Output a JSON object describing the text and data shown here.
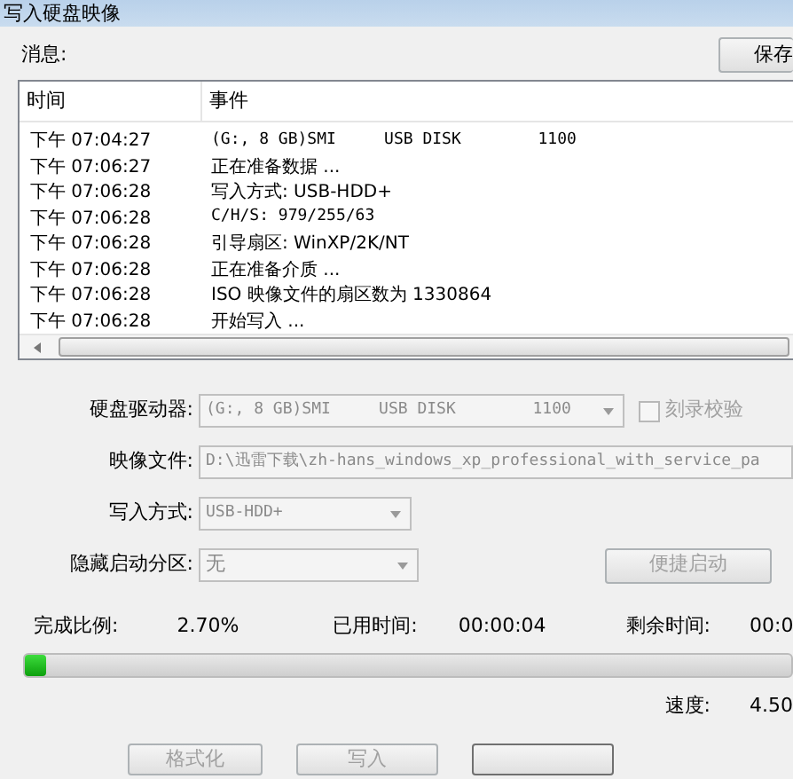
{
  "window": {
    "title": "写入硬盘映像"
  },
  "messages": {
    "label": "消息:",
    "save_button": "保存",
    "columns": [
      "时间",
      "事件"
    ],
    "rows": [
      {
        "time": "下午 07:04:27",
        "event": "(G:, 8 GB)SMI     USB DISK        1100"
      },
      {
        "time": "下午 07:06:27",
        "event": "正在准备数据 ..."
      },
      {
        "time": "下午 07:06:28",
        "event": "写入方式: USB-HDD+"
      },
      {
        "time": "下午 07:06:28",
        "event": "C/H/S: 979/255/63"
      },
      {
        "time": "下午 07:06:28",
        "event": "引导扇区: WinXP/2K/NT"
      },
      {
        "time": "下午 07:06:28",
        "event": "正在准备介质 ..."
      },
      {
        "time": "下午 07:06:28",
        "event": "ISO 映像文件的扇区数为 1330864"
      },
      {
        "time": "下午 07:06:28",
        "event": "开始写入 ..."
      }
    ]
  },
  "form": [
    {
      "kind": "select",
      "label": "硬盘驱动器:",
      "value": "(G:, 8 GB)SMI     USB DISK        1100",
      "disabled": true
    },
    {
      "kind": "text",
      "label": "映像文件:",
      "value": "D:\\迅雷下载\\zh-hans_windows_xp_professional_with_service_pa",
      "disabled": true
    },
    {
      "kind": "select",
      "label": "写入方式:",
      "value": "USB-HDD+",
      "disabled": true
    },
    {
      "kind": "select",
      "label": "隐藏启动分区:",
      "value": "无",
      "disabled": true
    }
  ],
  "verify": {
    "label": "刻录校验",
    "checked": false,
    "disabled": true
  },
  "quick_boot": {
    "label": "便捷启动",
    "disabled": true
  },
  "progress": {
    "done_label": "完成比例:",
    "done_value": "2.70%",
    "elapsed_label": "已用时间:",
    "elapsed_value": "00:00:04",
    "remaining_label": "剩余时间:",
    "remaining_value": "00:0",
    "level": 0.027,
    "speed_label": "速度:",
    "speed_value": "4.50"
  },
  "buttons": [
    {
      "label": "格式化",
      "disabled": true
    },
    {
      "label": "写入",
      "disabled": true
    }
  ]
}
